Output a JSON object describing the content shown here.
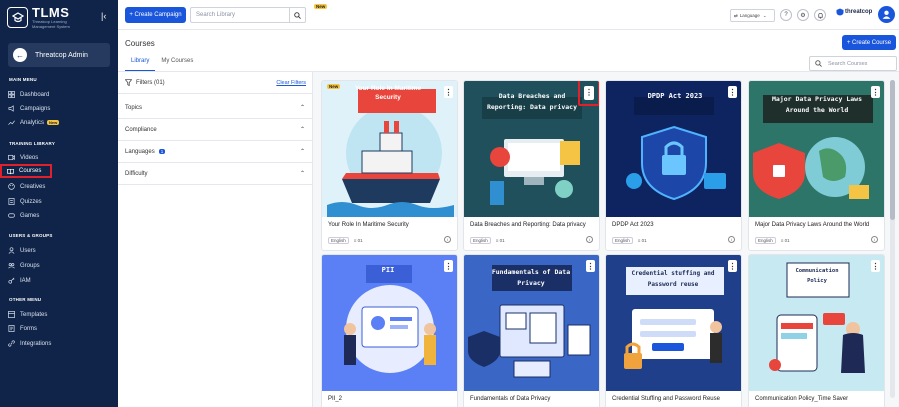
{
  "brand": {
    "name": "TLMS",
    "tagline": "Threatcop Learning Management System"
  },
  "admin": {
    "name": "Threatcop Admin"
  },
  "sidebar": {
    "sections": {
      "main": "MAIN MENU",
      "library": "TRAINING LIBRARY",
      "users": "USERS & GROUPS",
      "other": "OTHER MENU"
    },
    "items": [
      {
        "label": "Dashboard"
      },
      {
        "label": "Campaigns"
      },
      {
        "label": "Analytics",
        "badge": "New"
      },
      {
        "label": "Videos"
      },
      {
        "label": "Courses"
      },
      {
        "label": "Creatives"
      },
      {
        "label": "Quizzes"
      },
      {
        "label": "Games"
      },
      {
        "label": "Users"
      },
      {
        "label": "Groups"
      },
      {
        "label": "IAM"
      },
      {
        "label": "Templates"
      },
      {
        "label": "Forms"
      },
      {
        "label": "Integrations"
      }
    ]
  },
  "topbar": {
    "create_campaign": "+ Create Campaign",
    "search_placeholder": "Search Library",
    "new_tag": "New",
    "language": "Language",
    "logo": "threatcop"
  },
  "main": {
    "title": "Courses",
    "create_course": "+ Create Course",
    "tabs": [
      {
        "label": "Library"
      },
      {
        "label": "My Courses"
      }
    ],
    "search_placeholder": "Search Courses",
    "filters": {
      "title": "Filters (01)",
      "clear": "Clear Filters",
      "rows": [
        "Topics",
        "Compliance",
        "Languages",
        "Difficulty"
      ],
      "languages_count": "1"
    }
  },
  "cards": [
    {
      "title": "Your Role In Maritime Security",
      "thumb_text": "Your Role In Maritime Security",
      "lang": "English",
      "count": "01",
      "new": "New",
      "bg": "#dff2f9"
    },
    {
      "title": "Data Breaches and Reporting: Data privacy",
      "thumb_text": "Data Breaches and Reporting: Data privacy",
      "lang": "English",
      "count": "01",
      "bg": "#20505c"
    },
    {
      "title": "DPDP Act 2023",
      "thumb_text": "DPDP Act 2023",
      "lang": "English",
      "count": "01",
      "bg": "#0d2461"
    },
    {
      "title": "Major Data Privacy Laws Around the World",
      "thumb_text": "Major Data Privacy Laws Around the World",
      "lang": "English",
      "count": "01",
      "bg": "#2e7569"
    },
    {
      "title": "PII_2",
      "thumb_text": "PII",
      "lang": "English",
      "count": "01",
      "bg": "#5b7ff5"
    },
    {
      "title": "Fundamentals of Data Privacy",
      "thumb_text": "Fundamentals of Data Privacy",
      "lang": "English",
      "count": "01",
      "bg": "#3a66c6"
    },
    {
      "title": "Credential Stuffing and Password Reuse",
      "thumb_text": "Credential stuffing and Password reuse",
      "lang": "English",
      "count": "01",
      "bg": "#1f3f8a"
    },
    {
      "title": "Communication Policy_Time Saver",
      "thumb_text": "Communication Policy",
      "lang": "English",
      "count": "01",
      "bg": "#c6e9f2"
    }
  ]
}
